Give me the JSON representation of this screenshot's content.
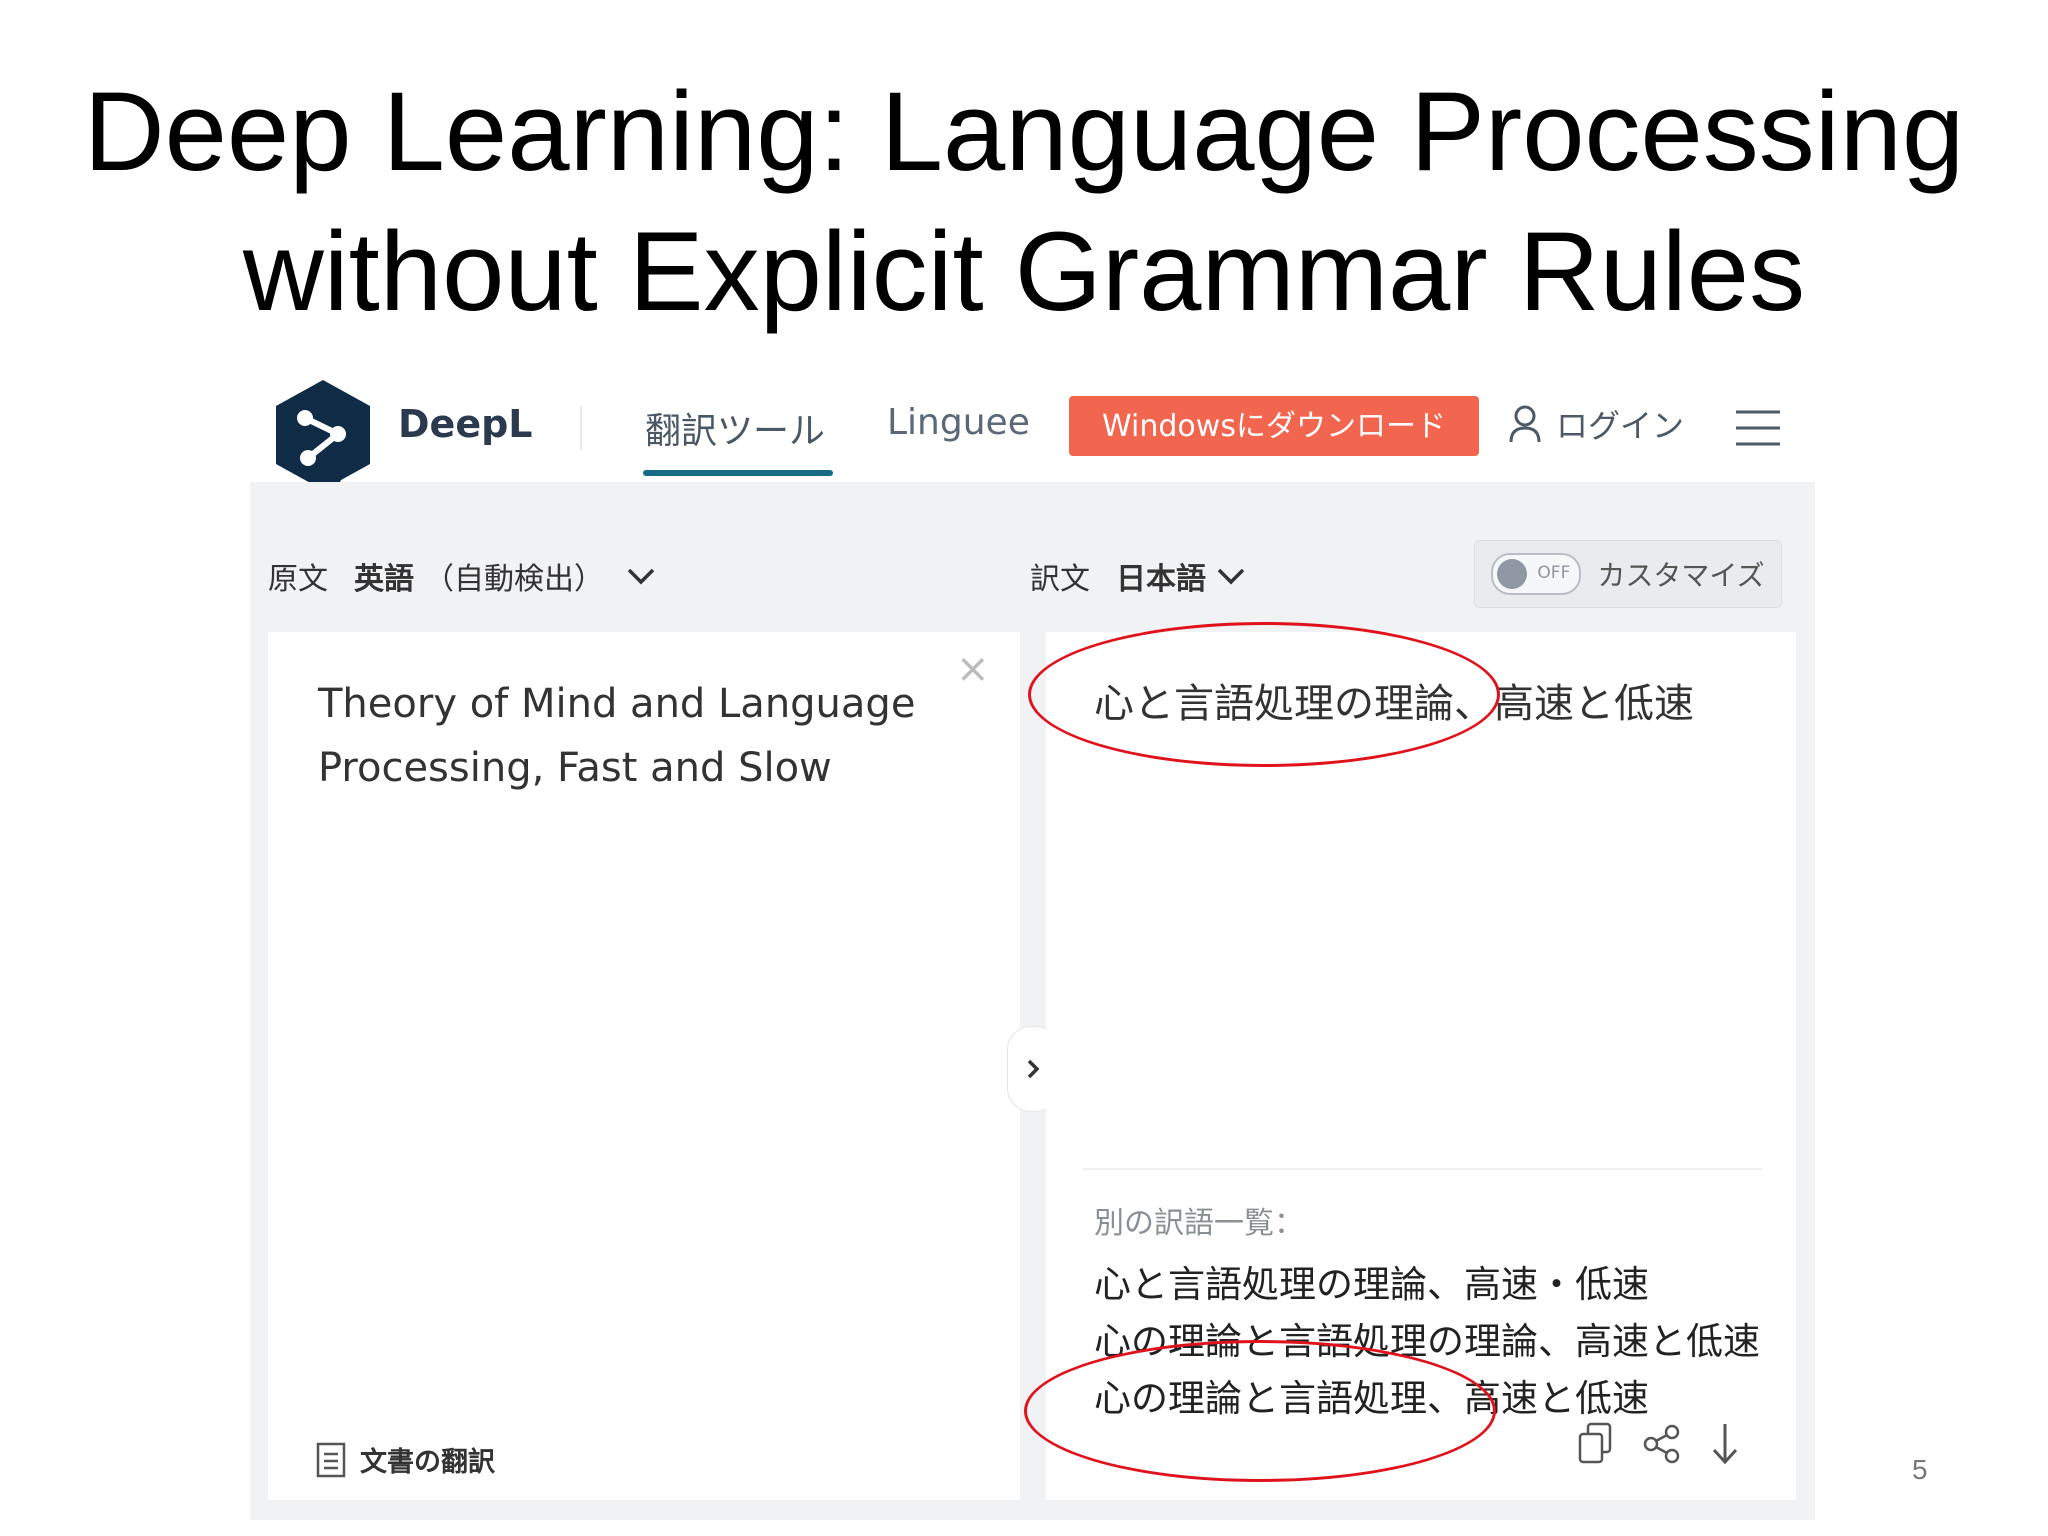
{
  "slide": {
    "title_line1": "Deep Learning: Language Processing",
    "title_line2": "without Explicit Grammar Rules",
    "page_number": "5"
  },
  "header": {
    "brand": "DeepL",
    "nav_translator": "翻訳ツール",
    "nav_linguee": "Linguee",
    "download_button": "Windowsにダウンロード",
    "login": "ログイン",
    "icons": [
      "deepl-logo-icon",
      "user-icon",
      "hamburger-menu-icon"
    ]
  },
  "source": {
    "label": "原文",
    "language": "英語",
    "mode": "（自動検出）",
    "text_line1": "Theory of Mind and Language",
    "text_line2": "Processing, Fast and Slow",
    "clear_symbol": "×",
    "document_translate": "文書の翻訳"
  },
  "target": {
    "label": "訳文",
    "language": "日本語",
    "customize_toggle_label": "OFF",
    "customize": "カスタマイズ",
    "translation": "心と言語処理の理論、高速と低速",
    "alternatives_label": "別の訳語一覧：",
    "alternatives": [
      "心と言語処理の理論、高速・低速",
      "心の理論と言語処理の理論、高速と低速",
      "心の理論と言語処理、高速と低速"
    ]
  },
  "colors": {
    "accent_teal": "#176b86",
    "download_button": "#f2664f",
    "logo_navy": "#0f2b46",
    "annotation_red": "#e0121c"
  }
}
